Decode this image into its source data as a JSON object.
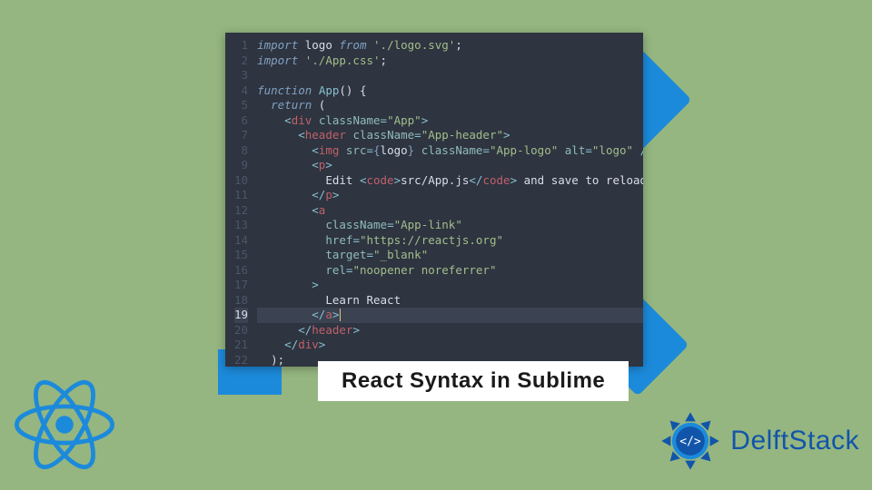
{
  "title": "React Syntax in Sublime",
  "brand": "DelftStack",
  "editor": {
    "highlighted_line": 19,
    "lines": [
      {
        "n": 1,
        "segs": [
          {
            "t": "import",
            "c": "kw"
          },
          {
            "t": " logo ",
            "c": "text"
          },
          {
            "t": "from",
            "c": "kw"
          },
          {
            "t": " ",
            "c": "text"
          },
          {
            "t": "'./logo.svg'",
            "c": "str"
          },
          {
            "t": ";",
            "c": "text"
          }
        ]
      },
      {
        "n": 2,
        "segs": [
          {
            "t": "import",
            "c": "kw"
          },
          {
            "t": " ",
            "c": "text"
          },
          {
            "t": "'./App.css'",
            "c": "str"
          },
          {
            "t": ";",
            "c": "text"
          }
        ]
      },
      {
        "n": 3,
        "segs": [
          {
            "t": "",
            "c": "text"
          }
        ]
      },
      {
        "n": 4,
        "segs": [
          {
            "t": "function",
            "c": "kw"
          },
          {
            "t": " ",
            "c": "text"
          },
          {
            "t": "App",
            "c": "fn"
          },
          {
            "t": "() {",
            "c": "text"
          }
        ]
      },
      {
        "n": 5,
        "segs": [
          {
            "t": "  ",
            "c": "text"
          },
          {
            "t": "return",
            "c": "kw"
          },
          {
            "t": " (",
            "c": "text"
          }
        ]
      },
      {
        "n": 6,
        "segs": [
          {
            "t": "    <",
            "c": "punc"
          },
          {
            "t": "div",
            "c": "tag"
          },
          {
            "t": " ",
            "c": "text"
          },
          {
            "t": "className",
            "c": "attr"
          },
          {
            "t": "=",
            "c": "punc"
          },
          {
            "t": "\"App\"",
            "c": "str"
          },
          {
            "t": ">",
            "c": "punc"
          }
        ]
      },
      {
        "n": 7,
        "segs": [
          {
            "t": "      <",
            "c": "punc"
          },
          {
            "t": "header",
            "c": "tag"
          },
          {
            "t": " ",
            "c": "text"
          },
          {
            "t": "className",
            "c": "attr"
          },
          {
            "t": "=",
            "c": "punc"
          },
          {
            "t": "\"App-header\"",
            "c": "str"
          },
          {
            "t": ">",
            "c": "punc"
          }
        ]
      },
      {
        "n": 8,
        "segs": [
          {
            "t": "        <",
            "c": "punc"
          },
          {
            "t": "img",
            "c": "tag"
          },
          {
            "t": " ",
            "c": "text"
          },
          {
            "t": "src",
            "c": "attr"
          },
          {
            "t": "=",
            "c": "punc"
          },
          {
            "t": "{",
            "c": "brace"
          },
          {
            "t": "logo",
            "c": "text"
          },
          {
            "t": "}",
            "c": "brace"
          },
          {
            "t": " ",
            "c": "text"
          },
          {
            "t": "className",
            "c": "attr"
          },
          {
            "t": "=",
            "c": "punc"
          },
          {
            "t": "\"App-logo\"",
            "c": "str"
          },
          {
            "t": " ",
            "c": "text"
          },
          {
            "t": "alt",
            "c": "attr"
          },
          {
            "t": "=",
            "c": "punc"
          },
          {
            "t": "\"logo\"",
            "c": "str"
          },
          {
            "t": " />",
            "c": "punc"
          }
        ]
      },
      {
        "n": 9,
        "segs": [
          {
            "t": "        <",
            "c": "punc"
          },
          {
            "t": "p",
            "c": "tag"
          },
          {
            "t": ">",
            "c": "punc"
          }
        ]
      },
      {
        "n": 10,
        "segs": [
          {
            "t": "          Edit ",
            "c": "text"
          },
          {
            "t": "<",
            "c": "punc"
          },
          {
            "t": "code",
            "c": "tag"
          },
          {
            "t": ">",
            "c": "punc"
          },
          {
            "t": "src/App.js",
            "c": "text"
          },
          {
            "t": "</",
            "c": "punc"
          },
          {
            "t": "code",
            "c": "tag"
          },
          {
            "t": ">",
            "c": "punc"
          },
          {
            "t": " and save to reload.",
            "c": "text"
          }
        ]
      },
      {
        "n": 11,
        "segs": [
          {
            "t": "        </",
            "c": "punc"
          },
          {
            "t": "p",
            "c": "tag"
          },
          {
            "t": ">",
            "c": "punc"
          }
        ]
      },
      {
        "n": 12,
        "segs": [
          {
            "t": "        <",
            "c": "punc"
          },
          {
            "t": "a",
            "c": "tag"
          }
        ]
      },
      {
        "n": 13,
        "segs": [
          {
            "t": "          ",
            "c": "text"
          },
          {
            "t": "className",
            "c": "attr"
          },
          {
            "t": "=",
            "c": "punc"
          },
          {
            "t": "\"App-link\"",
            "c": "str"
          }
        ]
      },
      {
        "n": 14,
        "segs": [
          {
            "t": "          ",
            "c": "text"
          },
          {
            "t": "href",
            "c": "attr"
          },
          {
            "t": "=",
            "c": "punc"
          },
          {
            "t": "\"https://reactjs.org\"",
            "c": "str"
          }
        ]
      },
      {
        "n": 15,
        "segs": [
          {
            "t": "          ",
            "c": "text"
          },
          {
            "t": "target",
            "c": "attr"
          },
          {
            "t": "=",
            "c": "punc"
          },
          {
            "t": "\"_blank\"",
            "c": "str"
          }
        ]
      },
      {
        "n": 16,
        "segs": [
          {
            "t": "          ",
            "c": "text"
          },
          {
            "t": "rel",
            "c": "attr"
          },
          {
            "t": "=",
            "c": "punc"
          },
          {
            "t": "\"noopener noreferrer\"",
            "c": "str"
          }
        ]
      },
      {
        "n": 17,
        "segs": [
          {
            "t": "        >",
            "c": "punc"
          }
        ]
      },
      {
        "n": 18,
        "segs": [
          {
            "t": "          Learn React",
            "c": "text"
          }
        ]
      },
      {
        "n": 19,
        "segs": [
          {
            "t": "        </",
            "c": "punc"
          },
          {
            "t": "a",
            "c": "tag"
          },
          {
            "t": ">",
            "c": "punc"
          }
        ],
        "cursor": true
      },
      {
        "n": 20,
        "segs": [
          {
            "t": "      </",
            "c": "punc"
          },
          {
            "t": "header",
            "c": "tag"
          },
          {
            "t": ">",
            "c": "punc"
          }
        ]
      },
      {
        "n": 21,
        "segs": [
          {
            "t": "    </",
            "c": "punc"
          },
          {
            "t": "div",
            "c": "tag"
          },
          {
            "t": ">",
            "c": "punc"
          }
        ]
      },
      {
        "n": 22,
        "segs": [
          {
            "t": "  );",
            "c": "text"
          }
        ]
      }
    ]
  }
}
